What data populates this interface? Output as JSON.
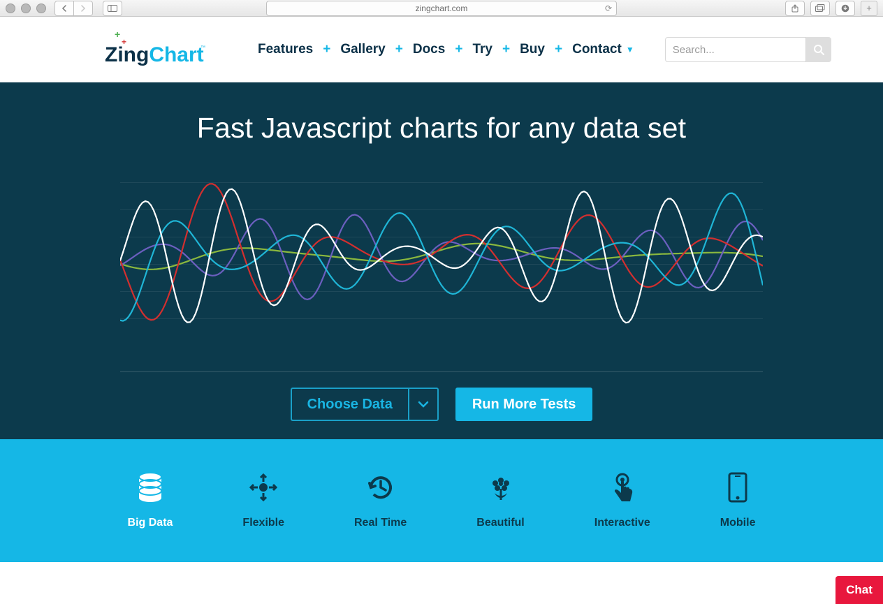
{
  "browser": {
    "url_display": "zingchart.com"
  },
  "logo": {
    "zing": "Zing",
    "chart": "Chart"
  },
  "nav": {
    "items": [
      "Features",
      "Gallery",
      "Docs",
      "Try",
      "Buy",
      "Contact"
    ]
  },
  "search": {
    "placeholder": "Search..."
  },
  "hero": {
    "title": "Fast Javascript charts for any data set",
    "choose_label": "Choose Data",
    "run_label": "Run More Tests"
  },
  "features": {
    "items": [
      {
        "label": "Big Data",
        "icon": "database-icon",
        "selected": true
      },
      {
        "label": "Flexible",
        "icon": "arrows-out-icon",
        "selected": false
      },
      {
        "label": "Real Time",
        "icon": "clock-back-icon",
        "selected": false
      },
      {
        "label": "Beautiful",
        "icon": "flower-icon",
        "selected": false
      },
      {
        "label": "Interactive",
        "icon": "tap-icon",
        "selected": false
      },
      {
        "label": "Mobile",
        "icon": "phone-icon",
        "selected": false
      }
    ]
  },
  "chat": {
    "label": "Chat"
  },
  "colors": {
    "hero_bg": "#0c3a4c",
    "accent": "#15b7e6",
    "brand_dark": "#0c3148",
    "series": {
      "red": "#d22f2f",
      "cyan": "#1fb5d6",
      "white": "#ffffff",
      "purple": "#6b5fbf",
      "green": "#8ab83e"
    }
  }
}
